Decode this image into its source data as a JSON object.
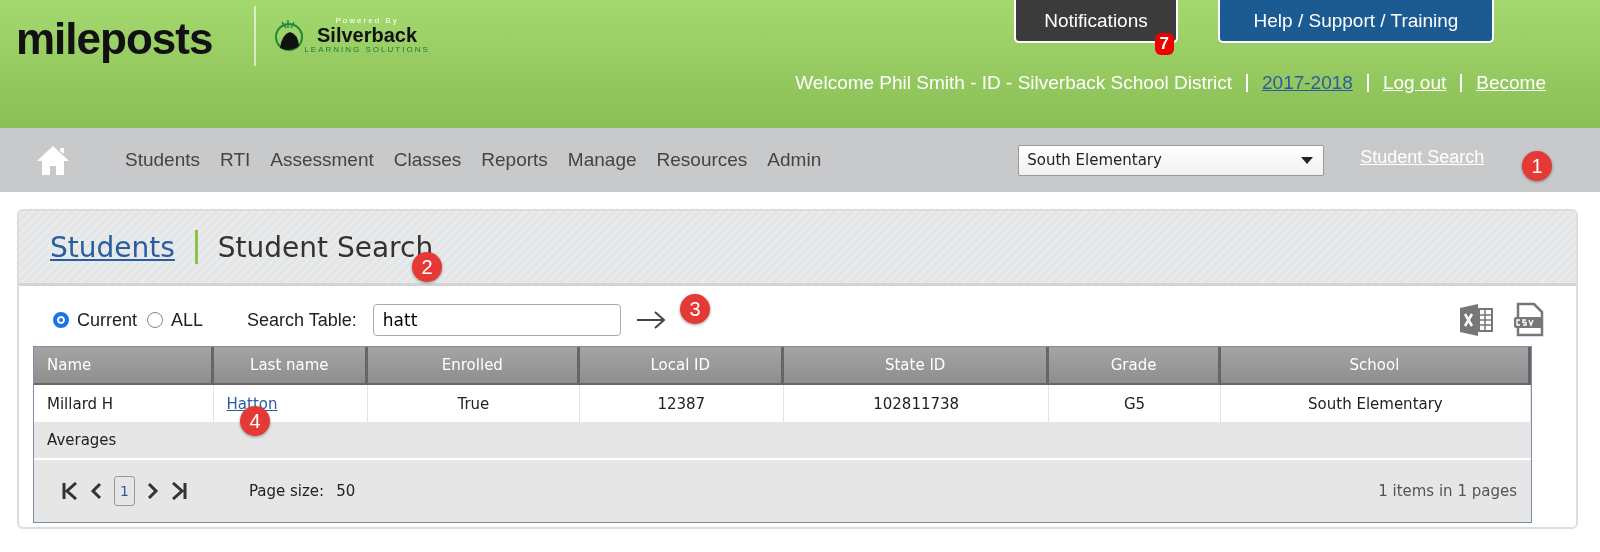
{
  "header": {
    "logo": {
      "text": "mileposts",
      "powered_by": "Powered By",
      "partner": "Silverback",
      "partner_sub": "LEARNING SOLUTIONS"
    },
    "buttons": [
      {
        "label": "Notifications",
        "kind": "dark",
        "badge": "7"
      },
      {
        "label": "Help / Support / Training",
        "kind": "blue"
      }
    ],
    "welcome": "Welcome Phil Smith - ID - Silverback School District",
    "links": [
      {
        "label": "2017-2018",
        "kind": "blue"
      },
      {
        "label": "Log out",
        "kind": "white"
      },
      {
        "label": "Become",
        "kind": "white"
      }
    ]
  },
  "nav": {
    "items": [
      "Students",
      "RTI",
      "Assessment",
      "Classes",
      "Reports",
      "Manage",
      "Resources",
      "Admin"
    ],
    "school_select": "South Elementary",
    "student_search": "Student Search"
  },
  "page": {
    "breadcrumb": "Students",
    "title": "Student Search"
  },
  "filters": [
    {
      "label": "Current",
      "selected": true
    },
    {
      "label": "ALL",
      "selected": false
    }
  ],
  "search": {
    "label": "Search Table:",
    "value": "hatt"
  },
  "table": {
    "columns": [
      "Name",
      "Last name",
      "Enrolled",
      "Local ID",
      "State ID",
      "Grade",
      "School"
    ],
    "rows": [
      [
        "Millard H",
        "Hatton",
        "True",
        "12387",
        "102811738",
        "G5",
        "South Elementary"
      ]
    ],
    "averages": "Averages",
    "pager": {
      "page": "1",
      "page_size_label": "Page size:",
      "page_size": "50",
      "summary": "1 items in 1 pages"
    }
  },
  "annotations": [
    "1",
    "2",
    "3",
    "4"
  ]
}
